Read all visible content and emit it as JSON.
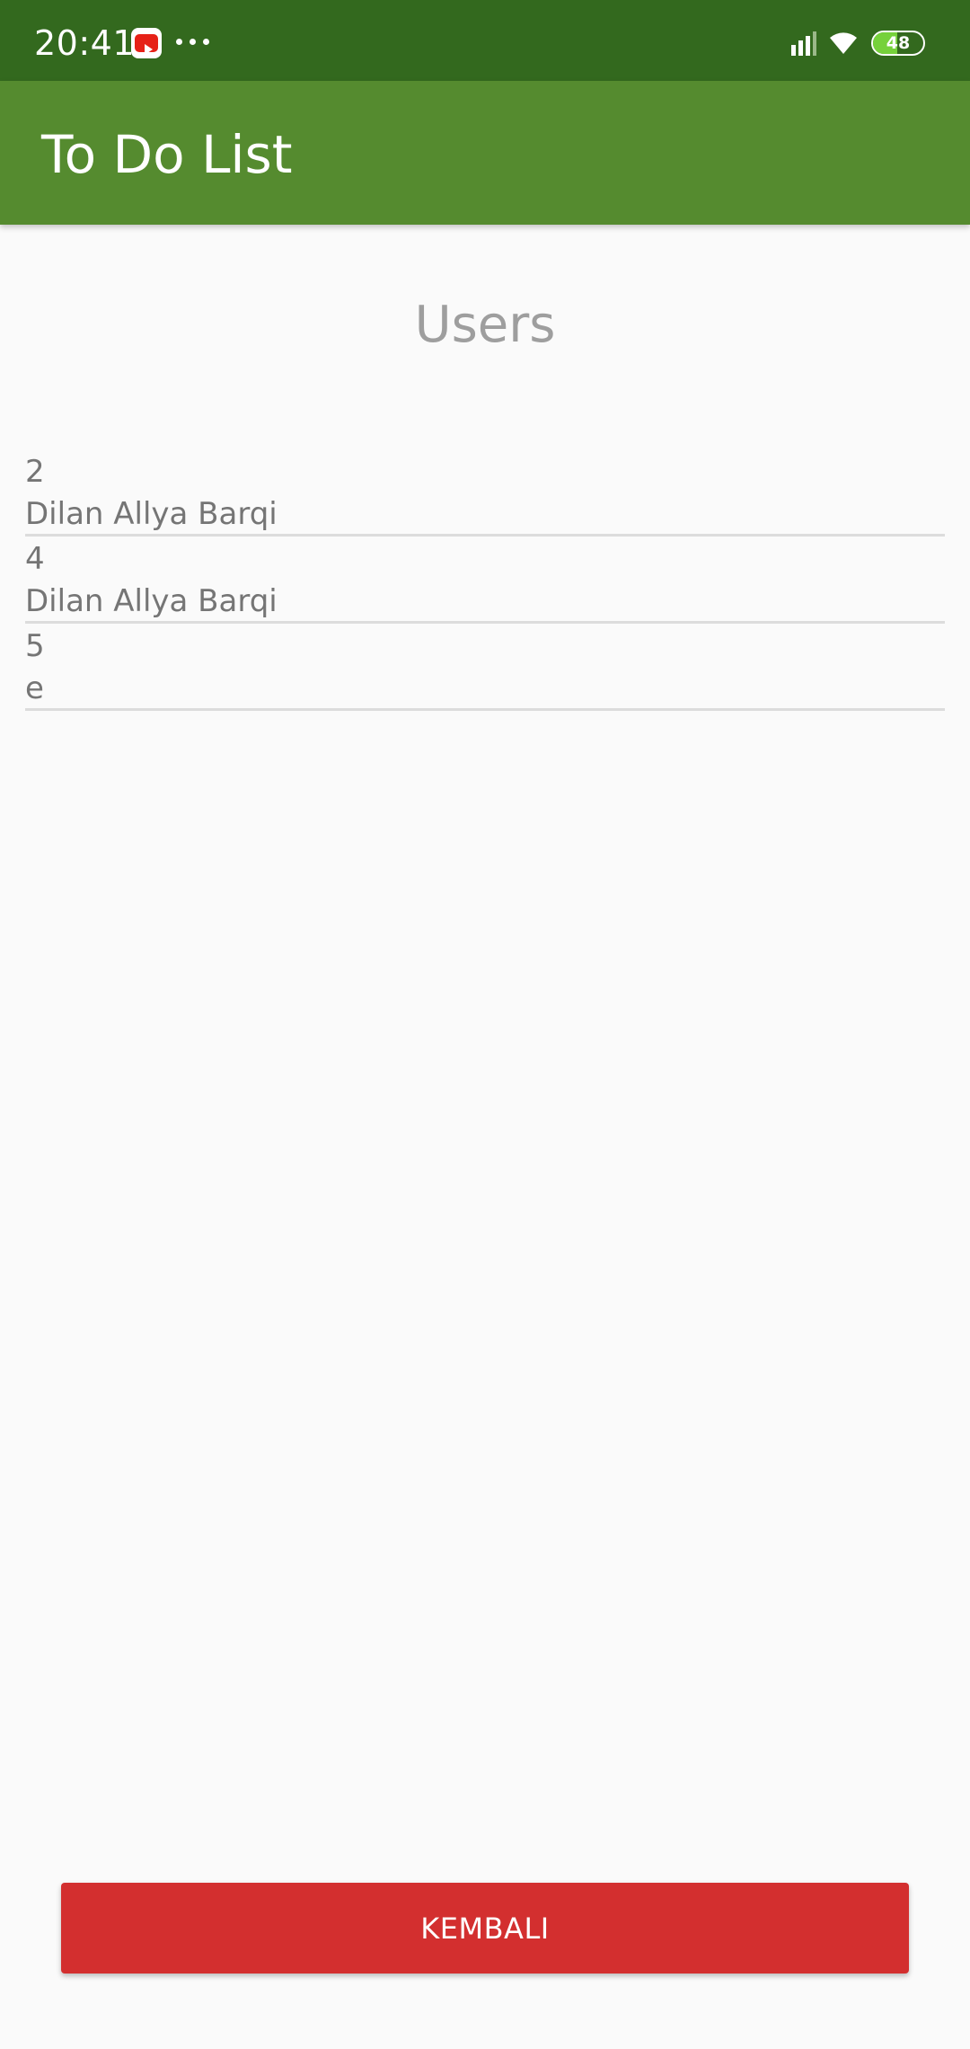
{
  "status_bar": {
    "time": "20:41",
    "notification_icons": [
      "youtube-icon",
      "more-icon"
    ],
    "system_icons": [
      "signal-icon",
      "wifi-icon",
      "battery-icon"
    ],
    "battery_level": "48"
  },
  "app_bar": {
    "title": "To Do List"
  },
  "main": {
    "heading": "Users",
    "users": [
      {
        "id": "2",
        "name": "Dilan Allya Barqi"
      },
      {
        "id": "4",
        "name": "Dilan Allya Barqi"
      },
      {
        "id": "5",
        "name": "e"
      }
    ]
  },
  "footer": {
    "back_label": "KEMBALI"
  },
  "colors": {
    "status_bar": "#33691e",
    "app_bar": "#558b2f",
    "button": "#d32f2f",
    "battery_fill": "#76d13b"
  }
}
